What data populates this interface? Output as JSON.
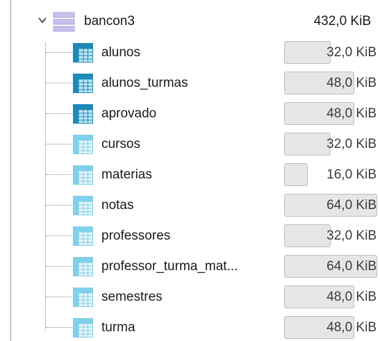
{
  "database": {
    "name": "bancon3",
    "size": "432,0 KiB",
    "icon": "database-icon",
    "expanded": true
  },
  "colors": {
    "table_icon_dark": "#1e8ab8",
    "table_icon_light": "#7fd0e8",
    "db_icon": "#b9b3e6",
    "size_bar_fill": "#e6e6e6",
    "size_bar_border": "#bdbdbd"
  },
  "tables": [
    {
      "name": "alunos",
      "size": "32,0 KiB",
      "size_fraction": 0.5,
      "icon": "table-icon",
      "icon_variant": "dark"
    },
    {
      "name": "alunos_turmas",
      "size": "48,0 KiB",
      "size_fraction": 0.75,
      "icon": "table-icon",
      "icon_variant": "dark"
    },
    {
      "name": "aprovado",
      "size": "48,0 KiB",
      "size_fraction": 0.75,
      "icon": "table-icon",
      "icon_variant": "dark"
    },
    {
      "name": "cursos",
      "size": "32,0 KiB",
      "size_fraction": 0.5,
      "icon": "table-icon",
      "icon_variant": "light"
    },
    {
      "name": "materias",
      "size": "16,0 KiB",
      "size_fraction": 0.25,
      "icon": "table-icon",
      "icon_variant": "light"
    },
    {
      "name": "notas",
      "size": "64,0 KiB",
      "size_fraction": 1.0,
      "icon": "table-icon",
      "icon_variant": "light"
    },
    {
      "name": "professores",
      "size": "32,0 KiB",
      "size_fraction": 0.5,
      "icon": "table-icon",
      "icon_variant": "light"
    },
    {
      "name": "professor_turma_mat...",
      "size": "64,0 KiB",
      "size_fraction": 1.0,
      "icon": "table-icon",
      "icon_variant": "light"
    },
    {
      "name": "semestres",
      "size": "48,0 KiB",
      "size_fraction": 0.75,
      "icon": "table-icon",
      "icon_variant": "light"
    },
    {
      "name": "turma",
      "size": "48,0 KiB",
      "size_fraction": 0.75,
      "icon": "table-icon",
      "icon_variant": "light"
    }
  ]
}
